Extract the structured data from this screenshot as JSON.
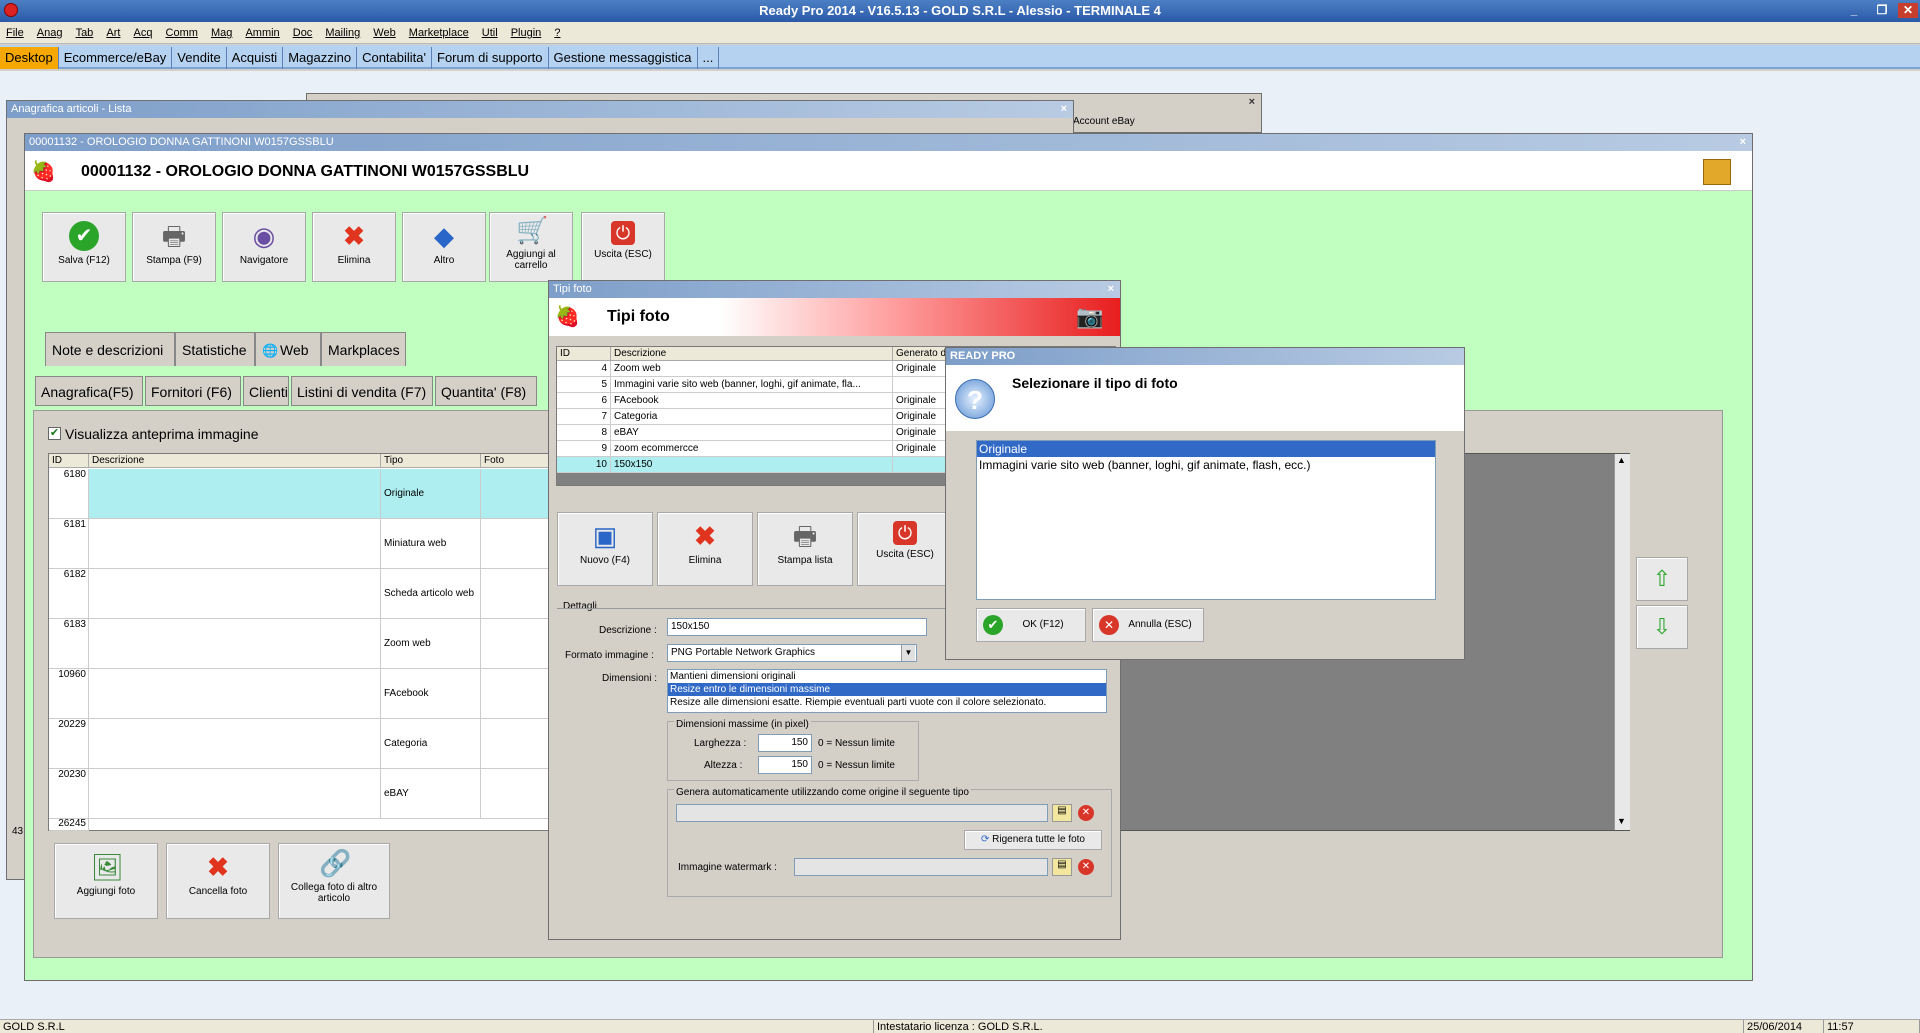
{
  "app": {
    "title": "Ready Pro 2014 - V16.5.13 - GOLD S.R.L - Alessio - TERMINALE 4",
    "window_buttons": [
      "_",
      "❐",
      "✕"
    ]
  },
  "menu": [
    "File",
    "Anag",
    "Tab",
    "Art",
    "Acq",
    "Comm",
    "Mag",
    "Ammin",
    "Doc",
    "Mailing",
    "Web",
    "Marketplace",
    "Util",
    "Plugin",
    "?"
  ],
  "tabs": [
    "Desktop",
    "Ecommerce/eBay",
    "Vendite",
    "Acquisti",
    "Magazzino",
    "Contabilita'",
    "Forum di supporto",
    "Gestione messaggistica",
    "..."
  ],
  "bg_windows": {
    "lista_title": "Anagrafica articoli  - Lista",
    "ebay_label": "Account eBay"
  },
  "article": {
    "window_title": "00001132 - OROLOGIO DONNA GATTINONI W0157GSSBLU",
    "header": "00001132 - OROLOGIO DONNA GATTINONI W0157GSSBLU",
    "toolbar": [
      {
        "label": "Salva (F12)",
        "icon": "check-icon"
      },
      {
        "label": "Stampa (F9)",
        "icon": "printer-icon"
      },
      {
        "label": "Navigatore",
        "icon": "navigator-icon"
      },
      {
        "label": "Elimina",
        "icon": "delete-icon"
      },
      {
        "label": "Altro",
        "icon": "more-icon"
      },
      {
        "label": "Aggiungi al carrello",
        "icon": "cart-icon"
      },
      {
        "label": "Uscita (ESC)",
        "icon": "exit-icon"
      }
    ],
    "tabs_row1": [
      "Note e descrizioni",
      "Statistiche",
      "Web",
      "Markplaces"
    ],
    "tabs_row2": [
      "Anagrafica(F5)",
      "Fornitori (F6)",
      "Clienti",
      "Listini di vendita (F7)",
      "Quantita' (F8)"
    ],
    "checkbox_label": "Visualizza anteprima immagine",
    "grid_headers": [
      "ID",
      "Descrizione",
      "Tipo",
      "Foto"
    ],
    "grid_rows": [
      {
        "id": "6180",
        "tipo": "Originale"
      },
      {
        "id": "6181",
        "tipo": "Miniatura web"
      },
      {
        "id": "6182",
        "tipo": "Scheda articolo web"
      },
      {
        "id": "6183",
        "tipo": "Zoom web"
      },
      {
        "id": "10960",
        "tipo": "FAcebook"
      },
      {
        "id": "20229",
        "tipo": "Categoria"
      },
      {
        "id": "20230",
        "tipo": "eBAY"
      }
    ],
    "grid_partial_id": "26245",
    "bottom_buttons": [
      "Aggiungi foto",
      "Cancella foto",
      "Collega foto di altro articolo"
    ],
    "left_edge_number": "43"
  },
  "tipi_foto": {
    "window_title": "Tipi foto",
    "header": "Tipi foto",
    "grid_headers": [
      "ID",
      "Descrizione",
      "Generato d"
    ],
    "rows": [
      {
        "id": "4",
        "desc": "Zoom web",
        "gen": "Originale"
      },
      {
        "id": "5",
        "desc": "Immagini varie sito web (banner, loghi, gif animate, fla...",
        "gen": ""
      },
      {
        "id": "6",
        "desc": "FAcebook",
        "gen": "Originale"
      },
      {
        "id": "7",
        "desc": "Categoria",
        "gen": "Originale"
      },
      {
        "id": "8",
        "desc": "eBAY",
        "gen": "Originale"
      },
      {
        "id": "9",
        "desc": "zoom ecommercce",
        "gen": "Originale"
      },
      {
        "id": "10",
        "desc": "150x150",
        "gen": ""
      }
    ],
    "buttons": [
      "Nuovo (F4)",
      "Elimina",
      "Stampa lista",
      "Uscita (ESC)"
    ],
    "details_label": "Dettagli",
    "descrizione_label": "Descrizione :",
    "descrizione_value": "150x150",
    "formato_label": "Formato immagine :",
    "formato_value": "PNG Portable Network Graphics",
    "dimensioni_label": "Dimensioni :",
    "dimensioni_options": [
      "Mantieni dimensioni originali",
      "Resize entro le dimensioni massime",
      "Resize alle dimensioni esatte. Riempie eventuali parti vuote con il colore selezionato."
    ],
    "max_dims_label": "Dimensioni massime (in pixel)",
    "larghezza_label": "Larghezza :",
    "larghezza_value": "150",
    "altezza_label": "Altezza :",
    "altezza_value": "150",
    "nessun_limite": "0 = Nessun limite",
    "genera_label": "Genera automaticamente utilizzando come origine il seguente tipo",
    "rigenera_label": "Rigenera tutte le foto",
    "watermark_label": "Immagine watermark :"
  },
  "dialog": {
    "window_title": "READY PRO",
    "message": "Selezionare il tipo di foto",
    "options": [
      "Originale",
      "Immagini varie sito web (banner, loghi, gif animate, flash, ecc.)"
    ],
    "ok_label": "OK (F12)",
    "cancel_label": "Annulla (ESC)"
  },
  "status": {
    "company": "GOLD S.R.L",
    "license": "Intestatario licenza : GOLD S.R.L.",
    "date": "25/06/2014",
    "time": "11:57"
  }
}
